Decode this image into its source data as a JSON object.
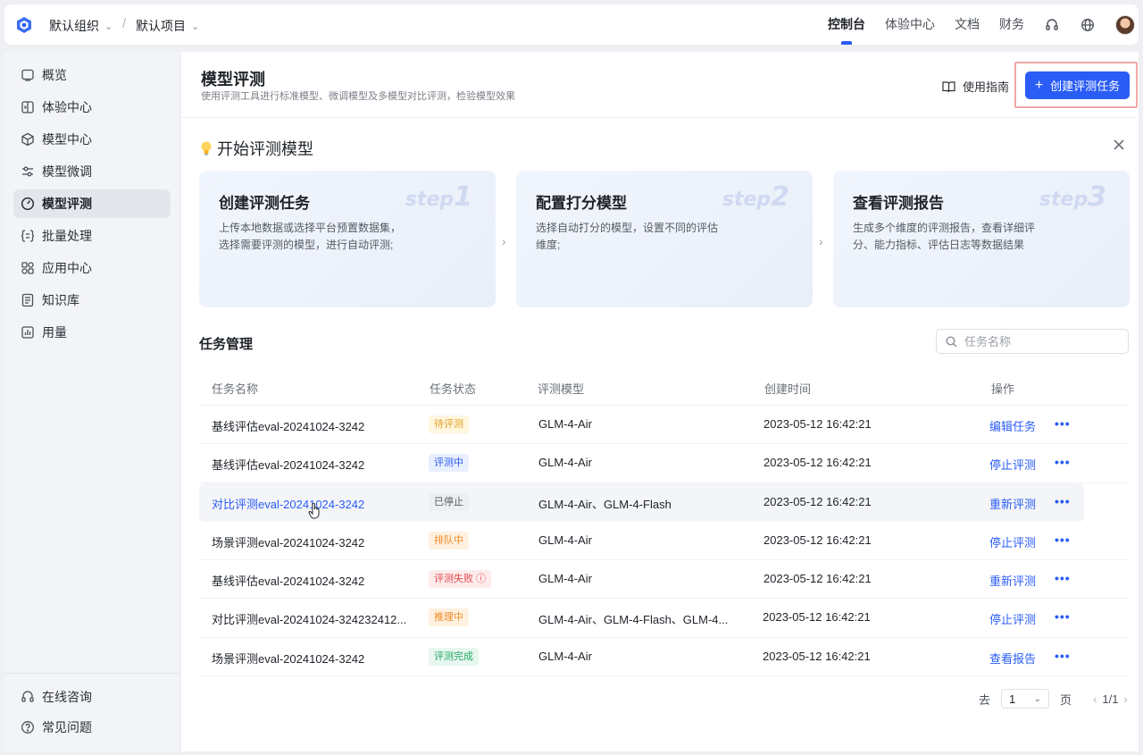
{
  "topbar": {
    "org": "默认组织",
    "project": "默认项目",
    "separator": "/",
    "nav": [
      {
        "label": "控制台",
        "active": true
      },
      {
        "label": "体验中心",
        "active": false
      },
      {
        "label": "文档",
        "active": false
      },
      {
        "label": "财务",
        "active": false
      }
    ],
    "icons": [
      "headset-icon",
      "globe-icon",
      "avatar"
    ],
    "accent": "#2a5cf6"
  },
  "sidebar": {
    "items": [
      {
        "label": "概览",
        "icon": "overview-icon",
        "active": false
      },
      {
        "label": "体验中心",
        "icon": "experience-icon",
        "active": false
      },
      {
        "label": "模型中心",
        "icon": "cube-icon",
        "active": false
      },
      {
        "label": "模型微调",
        "icon": "sliders-icon",
        "active": false
      },
      {
        "label": "模型评测",
        "icon": "gauge-icon",
        "active": true
      },
      {
        "label": "批量处理",
        "icon": "batch-icon",
        "active": false
      },
      {
        "label": "应用中心",
        "icon": "apps-icon",
        "active": false
      },
      {
        "label": "知识库",
        "icon": "book-icon",
        "active": false
      },
      {
        "label": "用量",
        "icon": "chart-icon",
        "active": false
      }
    ],
    "bottom": [
      {
        "label": "在线咨询",
        "icon": "headset-icon"
      },
      {
        "label": "常见问题",
        "icon": "question-icon"
      }
    ]
  },
  "header": {
    "title": "模型评测",
    "subtitle": "使用评测工具进行标准模型、微调模型及多模型对比评测，检验模型效果",
    "guide_label": "使用指南",
    "create_label": "创建评测任务"
  },
  "start": {
    "title": "开始评测模型",
    "steps": [
      {
        "title": "创建评测任务",
        "mark": "step",
        "num": "1",
        "desc": "上传本地数据或选择平台预置数据集，选择需要评测的模型，进行自动评测;"
      },
      {
        "title": "配置打分模型",
        "mark": "step",
        "num": "2",
        "desc": "选择自动打分的模型，设置不同的评估维度;"
      },
      {
        "title": "查看评测报告",
        "mark": "step",
        "num": "3",
        "desc": "生成多个维度的评测报告，查看详细评分、能力指标、评估日志等数据结果"
      }
    ]
  },
  "tasks": {
    "title": "任务管理",
    "search_placeholder": "任务名称",
    "columns": [
      "任务名称",
      "任务状态",
      "评测模型",
      "创建时间",
      "操作"
    ],
    "rows": [
      {
        "name": "基线评估eval-20241024-3242",
        "status": "待评测",
        "status_color": "yellow",
        "model": "GLM-4-Air",
        "time": "2023-05-12 16:42:21",
        "action": "编辑任务"
      },
      {
        "name": "基线评估eval-20241024-3242",
        "status": "评测中",
        "status_color": "blue",
        "model": "GLM-4-Air",
        "time": "2023-05-12 16:42:21",
        "action": "停止评测"
      },
      {
        "name": "对比评测eval-20241024-3242",
        "status": "已停止",
        "status_color": "gray",
        "model": "GLM-4-Air、GLM-4-Flash",
        "time": "2023-05-12 16:42:21",
        "action": "重新评测",
        "hover": true
      },
      {
        "name": "场景评测eval-20241024-3242",
        "status": "排队中",
        "status_color": "orange",
        "model": "GLM-4-Air",
        "time": "2023-05-12 16:42:21",
        "action": "停止评测"
      },
      {
        "name": "基线评估eval-20241024-3242",
        "status": "评测失败",
        "status_color": "red",
        "model": "GLM-4-Air",
        "time": "2023-05-12 16:42:21",
        "action": "重新评测"
      },
      {
        "name": "对比评测eval-20241024-324232412...",
        "status": "推理中",
        "status_color": "orange",
        "model": "GLM-4-Air、GLM-4-Flash、GLM-4...",
        "time": "2023-05-12 16:42:21",
        "action": "停止评测"
      },
      {
        "name": "场景评测eval-20241024-3242",
        "status": "评测完成",
        "status_color": "green",
        "model": "GLM-4-Air",
        "time": "2023-05-12 16:42:21",
        "action": "查看报告"
      }
    ],
    "more_label": "•••"
  },
  "pager": {
    "goto": "去",
    "page_value": "1",
    "page_suffix": "页",
    "summary": "1/1"
  }
}
